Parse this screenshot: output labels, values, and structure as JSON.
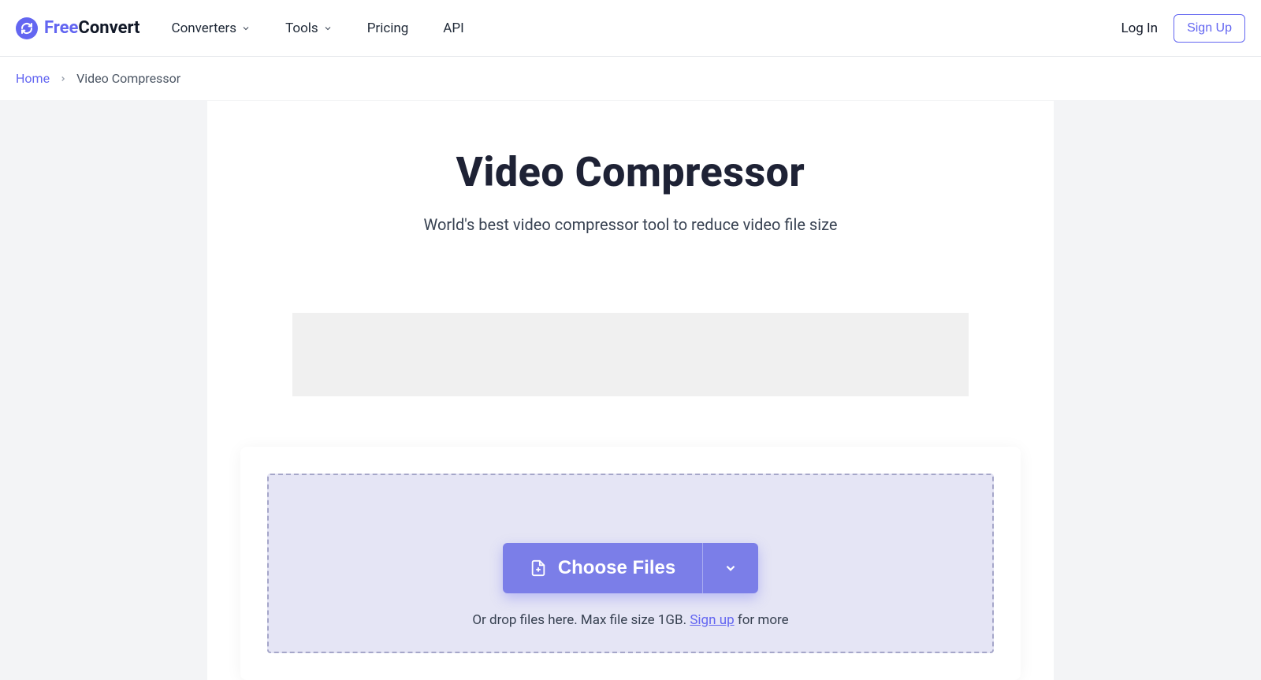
{
  "logo": {
    "free": "Free",
    "convert": "Convert"
  },
  "nav": {
    "converters": "Converters",
    "tools": "Tools",
    "pricing": "Pricing",
    "api": "API"
  },
  "auth": {
    "login": "Log In",
    "signup": "Sign Up"
  },
  "breadcrumb": {
    "home": "Home",
    "current": "Video Compressor"
  },
  "page": {
    "title": "Video Compressor",
    "subtitle": "World's best video compressor tool to reduce video file size"
  },
  "upload": {
    "button": "Choose Files",
    "drop_prefix": "Or drop files here. Max file size 1GB. ",
    "signup_link": "Sign up",
    "drop_suffix": " for more"
  }
}
